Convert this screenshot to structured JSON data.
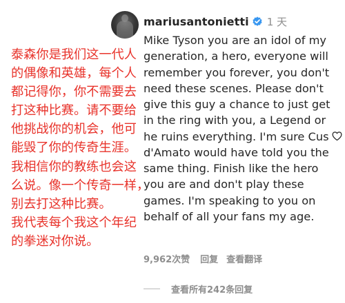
{
  "comment": {
    "username": "mariusantonietti",
    "time": "1 天",
    "text_lines": [
      "Mike Tyson you are an idol of my",
      "generation, a hero, everyone will",
      "remember you forever, you don't",
      "need these scenes. Please don't",
      "give this guy a chance to just get",
      "in the ring with you, a Legend or",
      "he ruins everything. I'm sure Cus",
      "d'Amato would have told you the",
      "same thing. Finish like the hero",
      "you are and don't play these",
      "games. I'm speaking to you on",
      "behalf of all your fans my age."
    ],
    "likes": "9,962次赞",
    "reply_label": "回复",
    "translate_label": "查看翻译",
    "view_replies": "查看所有242条回复"
  },
  "translation_overlay": {
    "color": "#e8332b",
    "lines": [
      "泰森你是我们这一代人",
      "的偶像和英雄，每个人",
      "都记得你，你不需要去",
      "打这种比赛。请不要给",
      "他挑战你的机会，他可",
      "能毁了你的传奇生涯。",
      "我相信你的教练也会这",
      "么说。像一个传奇一样，",
      "别去打这种比赛。",
      "我代表每个我这个年纪",
      "的拳迷对你说。"
    ]
  },
  "icons": {
    "verified": "verified-badge-icon",
    "like": "heart-outline-icon"
  },
  "colors": {
    "verified_blue": "#3897f0",
    "text": "#262626",
    "muted": "#8e8e8e"
  }
}
